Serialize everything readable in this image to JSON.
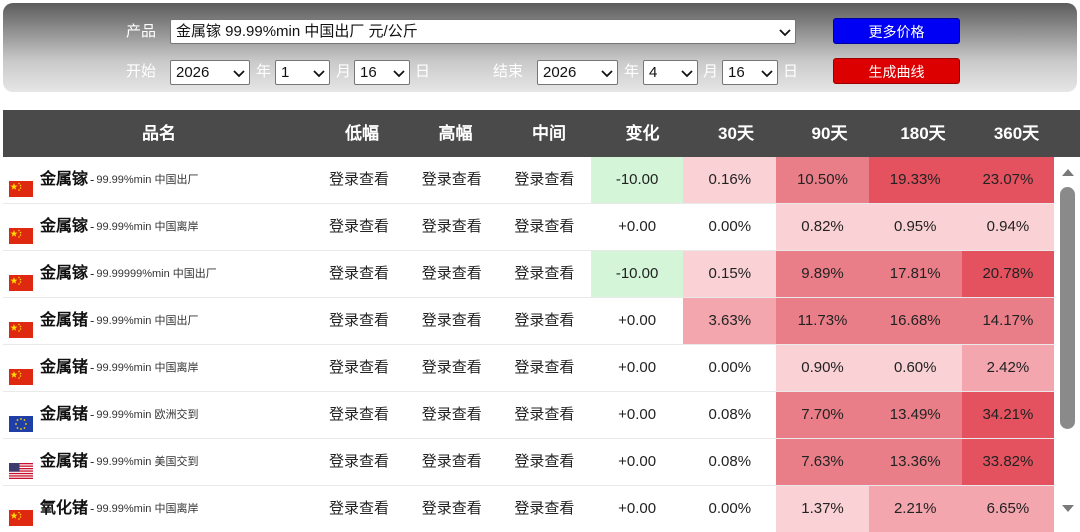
{
  "filter": {
    "product_label": "产品",
    "product_value": "金属镓 99.99%min 中国出厂 元/公斤",
    "start_label": "开始",
    "start_year": "2026",
    "start_month": "1",
    "start_day": "16",
    "end_label": "结束",
    "end_year": "2026",
    "end_month": "4",
    "end_day": "16",
    "year_unit": "年",
    "month_unit": "月",
    "day_unit": "日",
    "more_prices_button": "更多价格",
    "generate_curve_button": "生成曲线"
  },
  "table": {
    "headers": [
      "品名",
      "低幅",
      "高幅",
      "中间",
      "变化",
      "30天",
      "90天",
      "180天",
      "360天"
    ],
    "login_text": "登录查看",
    "colors": {
      "header_bg": "#4a4a4a",
      "change_negative_bg": "#d4f5d8",
      "heat_light": "#fad2d6",
      "heat_mid": "#f3a6ae",
      "heat_strong": "#ea7e88",
      "heat_hot": "#e4525f"
    },
    "rows": [
      {
        "flag": "china-flag-icon",
        "name": "金属镓",
        "dash": "-",
        "desc": "99.99%min 中国出厂",
        "change": "-10.00",
        "d30": "0.16%",
        "d90": "10.50%",
        "d180": "19.33%",
        "d360": "23.07%"
      },
      {
        "flag": "china-flag-icon",
        "name": "金属镓",
        "dash": "-",
        "desc": "99.99%min 中国离岸",
        "change": "+0.00",
        "d30": "0.00%",
        "d90": "0.82%",
        "d180": "0.95%",
        "d360": "0.94%"
      },
      {
        "flag": "china-flag-icon",
        "name": "金属镓",
        "dash": "-",
        "desc": "99.99999%min 中国出厂",
        "change": "-10.00",
        "d30": "0.15%",
        "d90": "9.89%",
        "d180": "17.81%",
        "d360": "20.78%"
      },
      {
        "flag": "china-flag-icon",
        "name": "金属锗",
        "dash": "-",
        "desc": "99.99%min 中国出厂",
        "change": "+0.00",
        "d30": "3.63%",
        "d90": "11.73%",
        "d180": "16.68%",
        "d360": "14.17%"
      },
      {
        "flag": "china-flag-icon",
        "name": "金属锗",
        "dash": "-",
        "desc": "99.99%min 中国离岸",
        "change": "+0.00",
        "d30": "0.00%",
        "d90": "0.90%",
        "d180": "0.60%",
        "d360": "2.42%"
      },
      {
        "flag": "eu-flag-icon",
        "name": "金属锗",
        "dash": "-",
        "desc": "99.99%min 欧洲交到",
        "change": "+0.00",
        "d30": "0.08%",
        "d90": "7.70%",
        "d180": "13.49%",
        "d360": "34.21%"
      },
      {
        "flag": "us-flag-icon",
        "name": "金属锗",
        "dash": "-",
        "desc": "99.99%min 美国交到",
        "change": "+0.00",
        "d30": "0.08%",
        "d90": "7.63%",
        "d180": "13.36%",
        "d360": "33.82%"
      },
      {
        "flag": "china-flag-icon",
        "name": "氧化锗",
        "dash": "-",
        "desc": "99.99%min 中国离岸",
        "change": "+0.00",
        "d30": "0.00%",
        "d90": "1.37%",
        "d180": "2.21%",
        "d360": "6.65%"
      }
    ]
  }
}
